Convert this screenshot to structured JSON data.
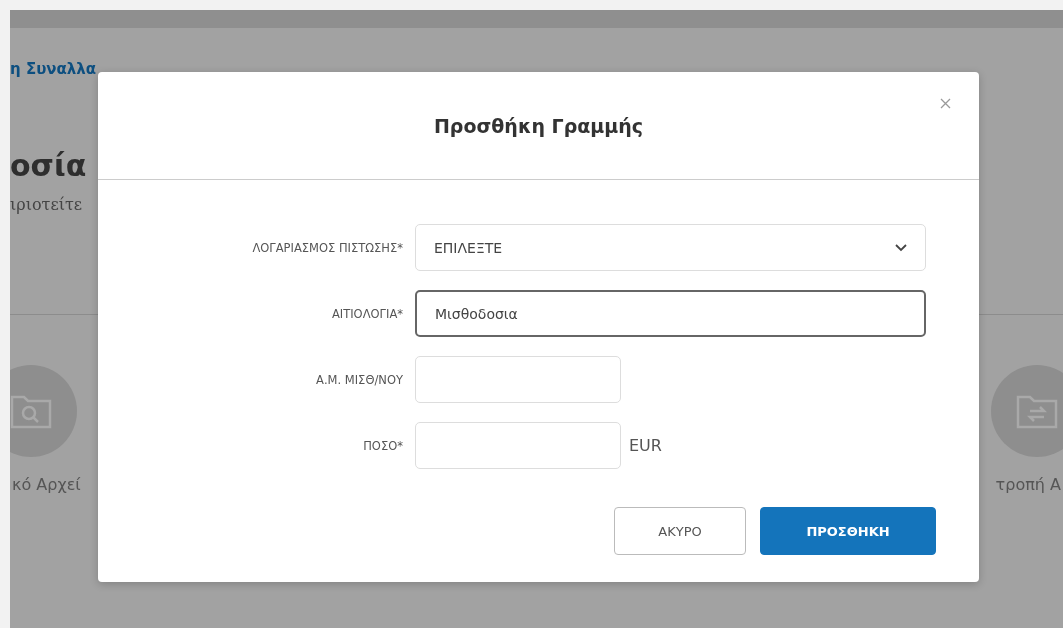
{
  "background": {
    "breadcrumb": "η Συναλλα",
    "heading": "οσία",
    "subtitle": "ιριοτείτε",
    "left_tile": "κό Αρχεί",
    "right_tile": "τροπή Α"
  },
  "dialog": {
    "title": "Προσθήκη Γραμμής",
    "fields": [
      {
        "kind": "select",
        "label": "ΛΟΓΑΡΙΑΣΜΟΣ ΠΙΣΤΩΣΗΣ*",
        "value": "ΕΠΙΛΕΞΤΕ",
        "focused": false
      },
      {
        "kind": "text",
        "label": "ΑΙΤΙΟΛΟΓΙΑ*",
        "value": "Μισθοδοσια",
        "focused": true
      },
      {
        "kind": "short",
        "label": "Α.Μ. ΜΙΣΘ/ΝΟΥ",
        "focused": false
      },
      {
        "kind": "short",
        "label": "ΠΟΣΟ*",
        "suffix": "EUR",
        "focused": false
      }
    ],
    "buttons": [
      {
        "kind": "secondary",
        "label": "ΑΚΥΡΟ"
      },
      {
        "kind": "primary",
        "label": "ΠΡΟΣΘΗΚΗ"
      }
    ]
  }
}
